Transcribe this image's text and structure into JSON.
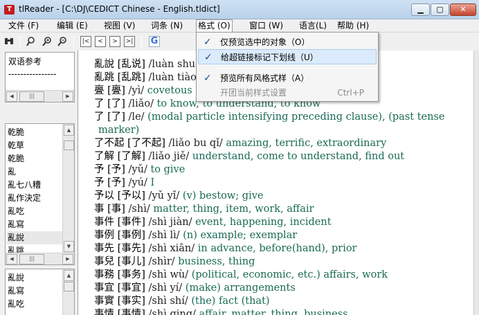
{
  "window": {
    "title": "tlReader - [C:\\DJ\\CEDICT Chinese - English.tldict]",
    "app_icon_glyph": "T"
  },
  "menu": {
    "items": [
      "文件 (F)",
      "编辑 (E)",
      "视图 (V)",
      "词条 (N)",
      "格式 (O)",
      "窗口 (W)",
      "语言(L)",
      "帮助 (H)"
    ]
  },
  "toolbar": {
    "search_glyph": "🔍",
    "zoom_in_glyph": "+",
    "zoom_out_glyph": "−",
    "nav": [
      "|<",
      "<",
      ">",
      ">|"
    ],
    "google_label": "G"
  },
  "left_top": {
    "heading": "双语参考",
    "divider": "----------------"
  },
  "left_list1": {
    "items": [
      "乾脆",
      "乾草",
      "乾脆",
      "亂",
      "亂七八糟",
      "亂作決定",
      "亂吃",
      "亂寫",
      "亂說",
      "亂跳"
    ],
    "selected_index": 8
  },
  "left_list2": {
    "items": [
      "亂說",
      "亂寫",
      "亂吃"
    ]
  },
  "entries": [
    {
      "hz": "亂說",
      "trad": "[乱说]",
      "py": "/luàn shuō/",
      "df": ""
    },
    {
      "hz": "亂跳",
      "trad": "[乱跳]",
      "py": "/luàn tiào/",
      "df": ""
    },
    {
      "hz": "亹",
      "trad": "[亹]",
      "py": "/yì/",
      "df": "covetous"
    },
    {
      "hz": "了",
      "trad": "[了]",
      "py": "/liǎo/",
      "df": "to know, to understand, to know"
    },
    {
      "hz": "了",
      "trad": "[了]",
      "py": "/le/",
      "df": "(modal particle intensifying preceding clause), (past tense"
    },
    {
      "hz": "",
      "trad": "",
      "py": "",
      "df": "marker)"
    },
    {
      "hz": "了不起",
      "trad": "[了不起]",
      "py": "/liǎo bu qǐ/",
      "df": "amazing, terrific, extraordinary"
    },
    {
      "hz": "了解",
      "trad": "[了解]",
      "py": "/liǎo jiě/",
      "df": "understand, come to understand, find out"
    },
    {
      "hz": "予",
      "trad": "[予]",
      "py": "/yǔ/",
      "df": "to give"
    },
    {
      "hz": "予",
      "trad": "[予]",
      "py": "/yú/",
      "df": "I"
    },
    {
      "hz": "予以",
      "trad": "[予以]",
      "py": "/yǔ yǐ/",
      "df": "(v) bestow; give"
    },
    {
      "hz": "事",
      "trad": "[事]",
      "py": "/shì/",
      "df": "matter, thing, item, work, affair"
    },
    {
      "hz": "事件",
      "trad": "[事件]",
      "py": "/shì jiàn/",
      "df": "event, happening, incident"
    },
    {
      "hz": "事例",
      "trad": "[事例]",
      "py": "/shì lì/",
      "df": "(n) example; exemplar"
    },
    {
      "hz": "事先",
      "trad": "[事先]",
      "py": "/shì xiān/",
      "df": "in advance, before(hand), prior"
    },
    {
      "hz": "事兒",
      "trad": "[事儿]",
      "py": "/shìr/",
      "df": "business, thing"
    },
    {
      "hz": "事務",
      "trad": "[事务]",
      "py": "/shì wù/",
      "df": "(political, economic, etc.) affairs, work"
    },
    {
      "hz": "事宜",
      "trad": "[事宜]",
      "py": "/shì yí/",
      "df": "(make) arrangements"
    },
    {
      "hz": "事實",
      "trad": "[事实]",
      "py": "/shì shí/",
      "df": "(the) fact (that)"
    },
    {
      "hz": "事情",
      "trad": "[事情]",
      "py": "/shì qing/",
      "df": "affair, matter, thing, business"
    }
  ],
  "dropdown": {
    "items": [
      {
        "label": "仅预览选中的对象（O）",
        "checked": true,
        "shortcut": "",
        "disabled": false,
        "hover": false
      },
      {
        "label": "给超链接标记下划线（U）",
        "checked": true,
        "shortcut": "",
        "disabled": false,
        "hover": true
      },
      {
        "label": "预览所有风格式样（A）",
        "checked": true,
        "shortcut": "",
        "disabled": false,
        "hover": false
      },
      {
        "label": "开团当前样式设置",
        "checked": false,
        "shortcut": "Ctrl+P",
        "disabled": true,
        "hover": false
      }
    ],
    "check_glyph": "✓"
  },
  "colors": {
    "definition": "#1a6a54",
    "menu_hover": "#dcebfb"
  }
}
